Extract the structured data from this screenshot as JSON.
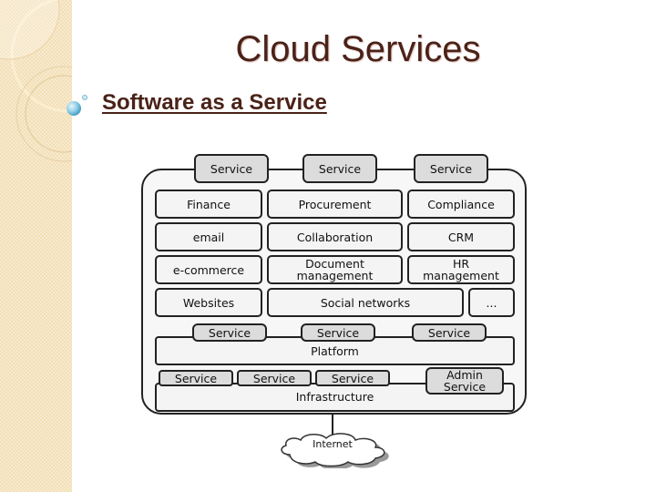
{
  "slide": {
    "title": "Cloud Services",
    "bullet": "Software as a Service"
  },
  "diagram": {
    "top_services": [
      "Service",
      "Service",
      "Service"
    ],
    "apps": [
      [
        "Finance",
        "Procurement",
        "Compliance"
      ],
      [
        "email",
        "Collaboration",
        "CRM"
      ],
      [
        "e-commerce",
        "Document management",
        "HR management"
      ],
      [
        "Websites",
        "Social networks",
        "..."
      ]
    ],
    "platform": {
      "label": "Platform",
      "services": [
        "Service",
        "Service",
        "Service"
      ]
    },
    "infrastructure": {
      "label": "Infrastructure",
      "services": [
        "Service",
        "Service",
        "Service"
      ],
      "admin": "Admin Service"
    },
    "internet": "Internet"
  },
  "colors": {
    "title": "#4a2218",
    "sidebar": "#f3dfb6",
    "service_fill": "#dcdcdc",
    "box_fill": "#f4f4f4"
  }
}
